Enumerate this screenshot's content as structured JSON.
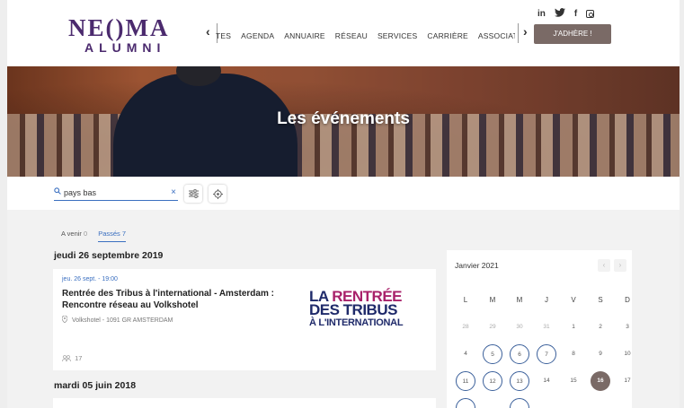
{
  "header": {
    "logo_top": "NE()MA",
    "logo_bottom": "ALUMNI",
    "nav_left_arrow": "‹",
    "nav_right_arrow": "›",
    "nav_items": [
      "TES",
      "AGENDA",
      "ANNUAIRE",
      "RÉSEAU",
      "SERVICES",
      "CARRIÈRE",
      "ASSOCIATION"
    ],
    "social": {
      "linkedin": "in",
      "twitter": "🐦",
      "facebook": "f"
    },
    "join_button": "J'ADHÈRE !"
  },
  "hero": {
    "title": "Les événements"
  },
  "search": {
    "value": "pays bas",
    "clear": "×",
    "filter_icon": "sliders-icon",
    "locate_icon": "target-icon"
  },
  "tabs": [
    {
      "label": "A venir",
      "count": "0"
    },
    {
      "label": "Passés",
      "count": "7"
    }
  ],
  "groups": [
    {
      "date": "jeudi 26 septembre 2019",
      "event": {
        "when": "jeu. 26 sept. - 19:00",
        "title": "Rentrée des Tribus à l'international - Amsterdam : Rencontre réseau au Volkshotel",
        "place": "Volkshotel - 1091 GR AMSTERDAM",
        "attendees": "17",
        "visual": {
          "line1a": "LA ",
          "line1b": "RENTRÉE",
          "line2": "DES TRIBUS",
          "line3": "À L'INTERNATIONAL"
        }
      }
    },
    {
      "date": "mardi 05 juin 2018"
    }
  ],
  "calendar": {
    "month": "Janvier 2021",
    "prev": "‹",
    "next": "›",
    "weekdays": [
      "L",
      "M",
      "M",
      "J",
      "V",
      "S",
      "D"
    ],
    "weeks": [
      [
        "28",
        "29",
        "30",
        "31",
        "1",
        "2",
        "3"
      ],
      [
        "4",
        "5",
        "6",
        "7",
        "8",
        "9",
        "10"
      ],
      [
        "11",
        "12",
        "13",
        "14",
        "15",
        "16",
        "17"
      ]
    ],
    "muted_days": [
      "28",
      "29",
      "30",
      "31"
    ],
    "event_days": [
      "5",
      "6",
      "7",
      "11",
      "12",
      "13"
    ],
    "today": "16",
    "colors": {
      "event_ring": "#3a5f9a",
      "today_fill": "#7a6a66"
    }
  },
  "colors": {
    "brand": "#4b2a6e",
    "accent": "#3a6fc0",
    "button": "#7a6a66"
  }
}
